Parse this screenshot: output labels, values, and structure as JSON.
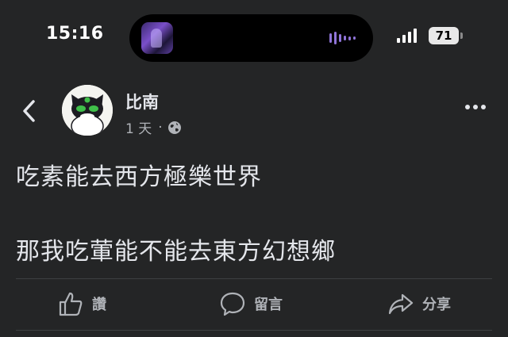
{
  "status_bar": {
    "time": "15:16",
    "battery": "71",
    "island_art_icon": "now-playing-artwork-icon",
    "waveform_icon": "audio-waveform-icon"
  },
  "header": {
    "back_icon": "chevron-left-icon",
    "author_name": "比南",
    "post_age": "1 天",
    "separator": "·",
    "privacy_icon": "globe-icon",
    "more_icon": "more-horizontal-icon"
  },
  "post": {
    "lines": [
      "吃素能去西方極樂世界",
      "那我吃葷能不能去東方幻想鄉"
    ]
  },
  "actions": [
    {
      "label": "讚",
      "icon": "thumbs-up-icon"
    },
    {
      "label": "留言",
      "icon": "comment-bubble-icon"
    },
    {
      "label": "分享",
      "icon": "share-arrow-icon"
    }
  ],
  "colors": {
    "background": "#242526",
    "text_primary": "#e4e6eb",
    "text_secondary": "#b0b3b8",
    "divider": "#3e4042"
  }
}
